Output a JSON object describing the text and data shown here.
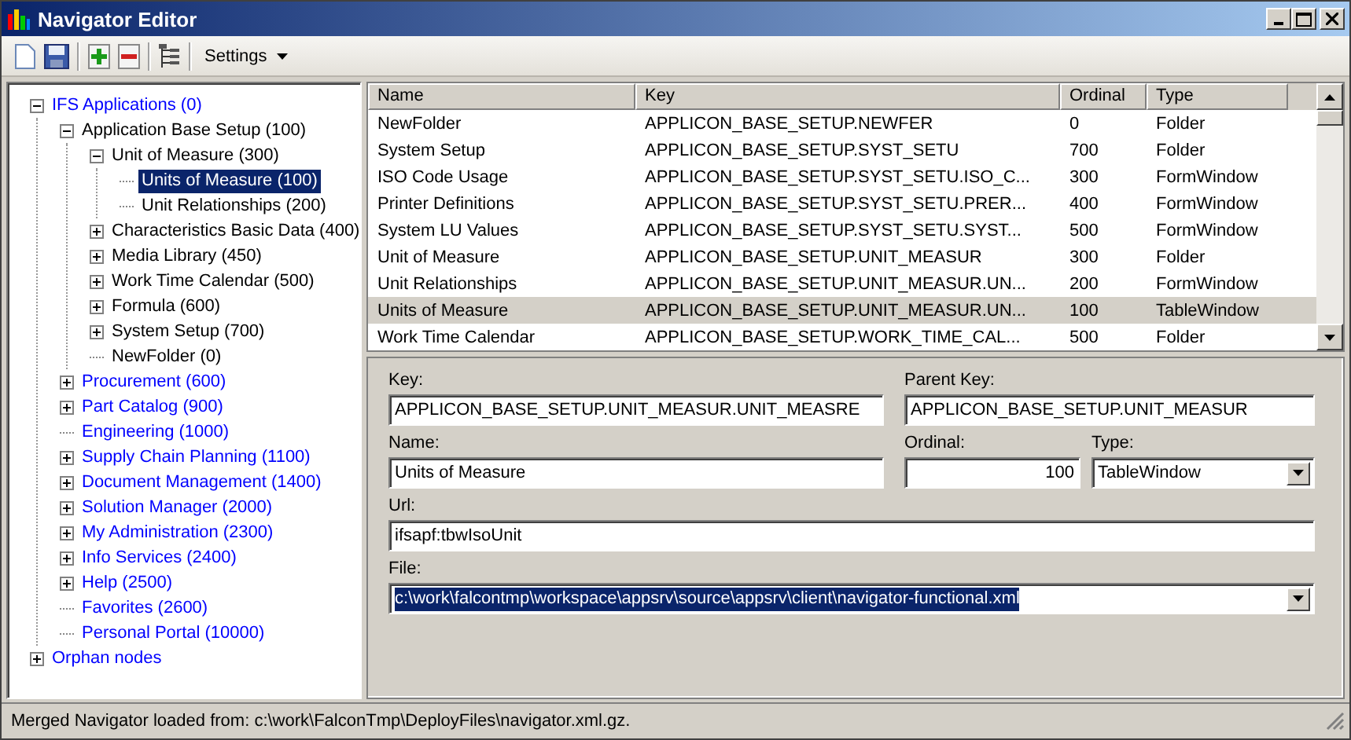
{
  "window": {
    "title": "Navigator Editor"
  },
  "toolbar": {
    "settings": "Settings"
  },
  "tree": [
    {
      "label": "IFS Applications  (0)",
      "color": "#0000ff",
      "expanded": true,
      "selected": false,
      "children": [
        {
          "label": "Application Base Setup  (100)",
          "color": "#000000",
          "expanded": true,
          "selected": false,
          "children": [
            {
              "label": "Unit of Measure  (300)",
              "color": "#000000",
              "expanded": true,
              "selected": false,
              "children": [
                {
                  "label": "Units of Measure  (100)",
                  "selected": true
                },
                {
                  "label": "Unit Relationships  (200)",
                  "color": "#000000",
                  "selected": false
                }
              ]
            },
            {
              "label": "Characteristics Basic Data  (400)",
              "color": "#000000",
              "expanded": false,
              "selected": false
            },
            {
              "label": "Media Library  (450)",
              "color": "#000000",
              "expanded": false,
              "selected": false
            },
            {
              "label": "Work Time Calendar  (500)",
              "color": "#000000",
              "expanded": false,
              "selected": false
            },
            {
              "label": "Formula  (600)",
              "color": "#000000",
              "expanded": false,
              "selected": false
            },
            {
              "label": "System Setup  (700)",
              "color": "#000000",
              "expanded": false,
              "selected": false
            },
            {
              "label": "NewFolder  (0)",
              "color": "#000000",
              "selected": false
            }
          ]
        },
        {
          "label": "Procurement  (600)",
          "color": "#0000ff",
          "expanded": false,
          "selected": false
        },
        {
          "label": "Part Catalog  (900)",
          "color": "#0000ff",
          "expanded": false,
          "selected": false
        },
        {
          "label": "Engineering  (1000)",
          "color": "#0000ff",
          "selected": false
        },
        {
          "label": "Supply Chain Planning  (1100)",
          "color": "#0000ff",
          "expanded": false,
          "selected": false
        },
        {
          "label": "Document Management  (1400)",
          "color": "#0000ff",
          "expanded": false,
          "selected": false
        },
        {
          "label": "Solution Manager  (2000)",
          "color": "#0000ff",
          "expanded": false,
          "selected": false
        },
        {
          "label": "My Administration  (2300)",
          "color": "#0000ff",
          "expanded": false,
          "selected": false
        },
        {
          "label": "Info Services  (2400)",
          "color": "#0000ff",
          "expanded": false,
          "selected": false
        },
        {
          "label": "Help  (2500)",
          "color": "#0000ff",
          "expanded": false,
          "selected": false
        },
        {
          "label": "Favorites  (2600)",
          "color": "#0000ff",
          "selected": false
        },
        {
          "label": "Personal Portal  (10000)",
          "color": "#0000ff",
          "selected": false
        }
      ]
    },
    {
      "label": "Orphan nodes",
      "color": "#0000ff",
      "expanded": false,
      "selected": false
    }
  ],
  "table": {
    "columns": [
      "Name",
      "Key",
      "Ordinal",
      "Type"
    ],
    "rows": [
      {
        "cells": [
          "NewFolder",
          "APPLICON_BASE_SETUP.NEWFER",
          "0",
          "Folder"
        ],
        "selected": false
      },
      {
        "cells": [
          "System Setup",
          "APPLICON_BASE_SETUP.SYST_SETU",
          "700",
          "Folder"
        ],
        "selected": false
      },
      {
        "cells": [
          "ISO Code Usage",
          "APPLICON_BASE_SETUP.SYST_SETU.ISO_C...",
          "300",
          "FormWindow"
        ],
        "selected": false
      },
      {
        "cells": [
          "Printer Definitions",
          "APPLICON_BASE_SETUP.SYST_SETU.PRER...",
          "400",
          "FormWindow"
        ],
        "selected": false
      },
      {
        "cells": [
          "System LU Values",
          "APPLICON_BASE_SETUP.SYST_SETU.SYST...",
          "500",
          "FormWindow"
        ],
        "selected": false
      },
      {
        "cells": [
          "Unit of Measure",
          "APPLICON_BASE_SETUP.UNIT_MEASUR",
          "300",
          "Folder"
        ],
        "selected": false
      },
      {
        "cells": [
          "Unit Relationships",
          "APPLICON_BASE_SETUP.UNIT_MEASUR.UN...",
          "200",
          "FormWindow"
        ],
        "selected": false
      },
      {
        "cells": [
          "Units of Measure",
          "APPLICON_BASE_SETUP.UNIT_MEASUR.UN...",
          "100",
          "TableWindow"
        ],
        "selected": true
      },
      {
        "cells": [
          "Work Time Calendar",
          "APPLICON_BASE_SETUP.WORK_TIME_CAL...",
          "500",
          "Folder"
        ],
        "selected": false
      }
    ]
  },
  "form": {
    "key": {
      "label": "Key:",
      "value": "APPLICON_BASE_SETUP.UNIT_MEASUR.UNIT_MEASRE"
    },
    "parent_key": {
      "label": "Parent Key:",
      "value": "APPLICON_BASE_SETUP.UNIT_MEASUR"
    },
    "name": {
      "label": "Name:",
      "value": "Units of Measure"
    },
    "ordinal": {
      "label": "Ordinal:",
      "value": "100"
    },
    "type": {
      "label": "Type:",
      "value": "TableWindow"
    },
    "url": {
      "label": "Url:",
      "value": "ifsapf:tbwIsoUnit"
    },
    "file": {
      "label": "File:",
      "value": "c:\\work\\falcontmp\\workspace\\appsrv\\source\\appsrv\\client\\navigator-functional.xml",
      "selected": true
    }
  },
  "status_bar": "Merged Navigator loaded from: c:\\work\\FalconTmp\\DeployFiles\\navigator.xml.gz."
}
